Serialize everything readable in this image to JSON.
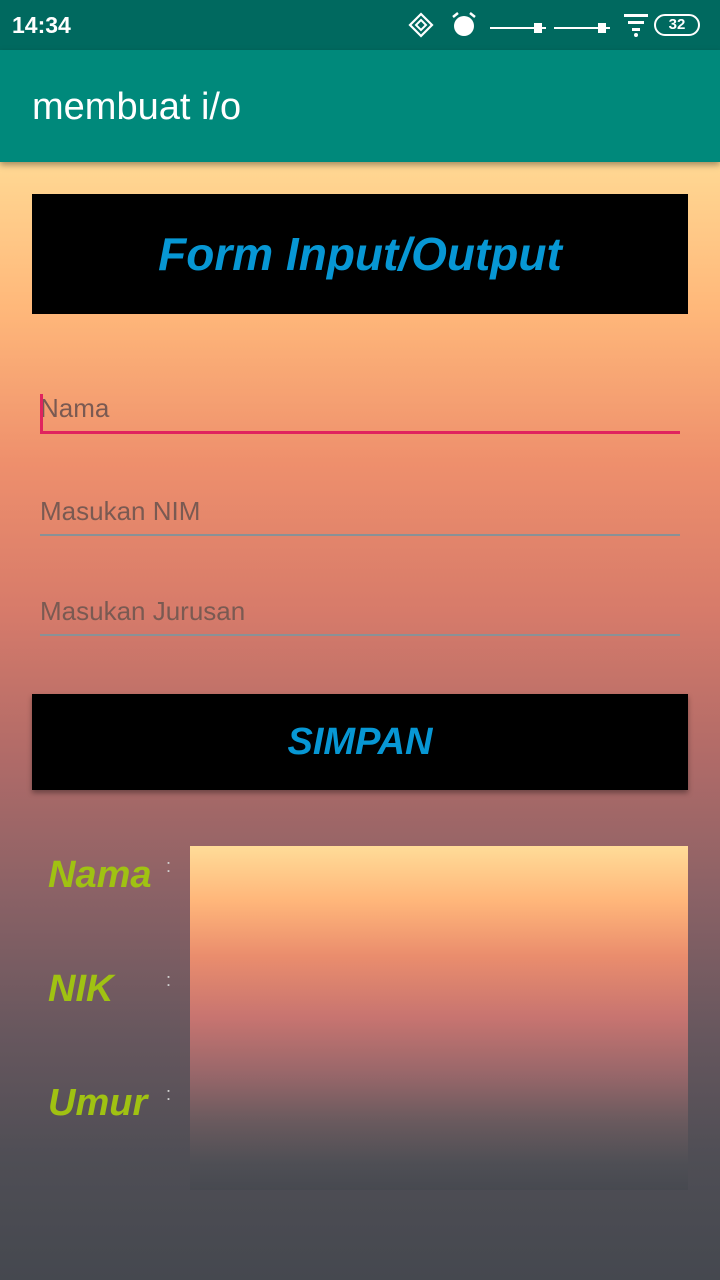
{
  "status_bar": {
    "time": "14:34",
    "battery": "32",
    "icons": [
      "sync-diamond-icon",
      "alarm-icon",
      "slider-icon",
      "slider-icon",
      "wifi-icon",
      "battery-icon"
    ]
  },
  "app_bar": {
    "title": "membuat i/o",
    "color": "#00897b"
  },
  "form": {
    "title": "Form Input/Output",
    "fields": [
      {
        "placeholder": "Nama",
        "value": ""
      },
      {
        "placeholder": "Masukan NIM",
        "value": ""
      },
      {
        "placeholder": "Masukan Jurusan",
        "value": ""
      }
    ],
    "submit_label": "SIMPAN"
  },
  "output": {
    "rows": [
      {
        "label": "Nama",
        "separator": ":"
      },
      {
        "label": "NIK",
        "separator": ":"
      },
      {
        "label": "Umur",
        "separator": ":"
      }
    ]
  },
  "colors": {
    "accent_blue": "#0797d4",
    "label_green": "#a0c212",
    "focus_pink": "#e0245e"
  }
}
